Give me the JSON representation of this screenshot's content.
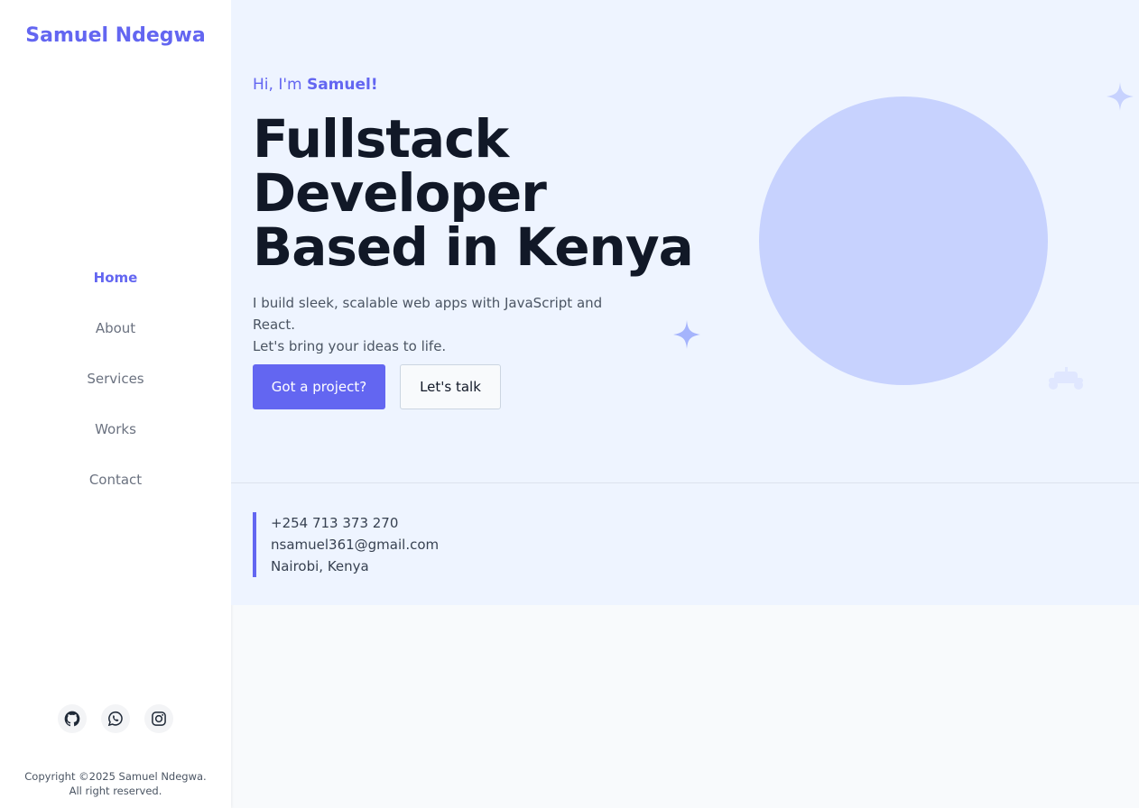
{
  "sidebar": {
    "brand": "Samuel Ndegwa",
    "nav": [
      {
        "label": "Home",
        "active": true
      },
      {
        "label": "About",
        "active": false
      },
      {
        "label": "Services",
        "active": false
      },
      {
        "label": "Works",
        "active": false
      },
      {
        "label": "Contact",
        "active": false
      }
    ],
    "socials": [
      {
        "icon": "github-icon"
      },
      {
        "icon": "whatsapp-icon"
      },
      {
        "icon": "instagram-icon"
      }
    ],
    "copyright_line1": "Copyright ©2025 Samuel Ndegwa.",
    "copyright_line2": "All right reserved."
  },
  "hero": {
    "greeting_prefix": "Hi, I'm",
    "greeting_name": "Samuel!",
    "headline_lines": [
      "Fullstack",
      "Developer",
      "Based in Kenya"
    ],
    "intro_line1": "I build sleek, scalable web apps with JavaScript and React.",
    "intro_line2": "Let's bring your ideas to life.",
    "primary_button": "Got a project?",
    "secondary_button": "Let's talk"
  },
  "contact": {
    "phone": "+254 713 373 270",
    "email": "nsamuel361@gmail.com",
    "location": "Nairobi, Kenya"
  },
  "colors": {
    "accent": "#6366f1",
    "hero_background": "#eef4ff",
    "portrait_circle": "#c7d2fe",
    "heading": "#111827"
  }
}
